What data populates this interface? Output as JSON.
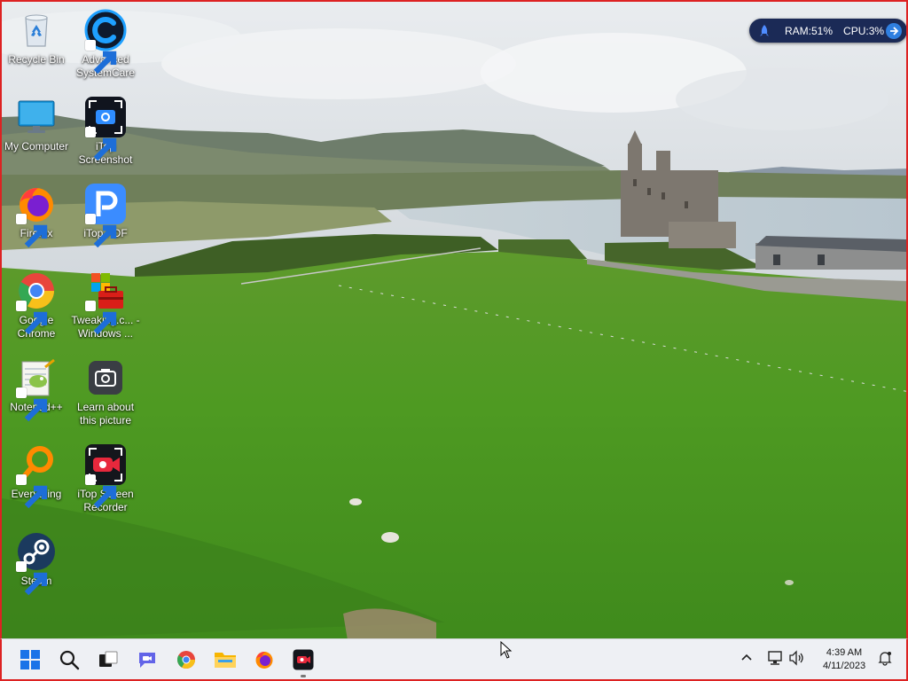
{
  "desktop_icons": [
    {
      "id": "recycle-bin",
      "label": "Recycle Bin"
    },
    {
      "id": "advanced-systemcare",
      "label": "Advanced SystemCare"
    },
    {
      "id": "my-computer",
      "label": "My Computer"
    },
    {
      "id": "itop-screenshot",
      "label": "iTop Screenshot"
    },
    {
      "id": "firefox",
      "label": "Firefox"
    },
    {
      "id": "itop-pdf",
      "label": "iTop PDF"
    },
    {
      "id": "google-chrome",
      "label": "Google Chrome"
    },
    {
      "id": "tweaking",
      "label": "Tweaking.c... - Windows ..."
    },
    {
      "id": "notepadpp",
      "label": "Notepad++"
    },
    {
      "id": "learn-about-picture",
      "label": "Learn about this picture"
    },
    {
      "id": "everything",
      "label": "Everything"
    },
    {
      "id": "itop-screen-recorder",
      "label": "iTop Screen Recorder"
    },
    {
      "id": "steam",
      "label": "Steam"
    }
  ],
  "monitor": {
    "ram": "RAM:51%",
    "cpu": "CPU:3%"
  },
  "clock": {
    "time": "4:39 AM",
    "date": "4/11/2023"
  },
  "colors": {
    "taskbar_bg": "#eef0f4",
    "widget_bg": "#1b2a56",
    "accent": "#2f7fe0"
  }
}
